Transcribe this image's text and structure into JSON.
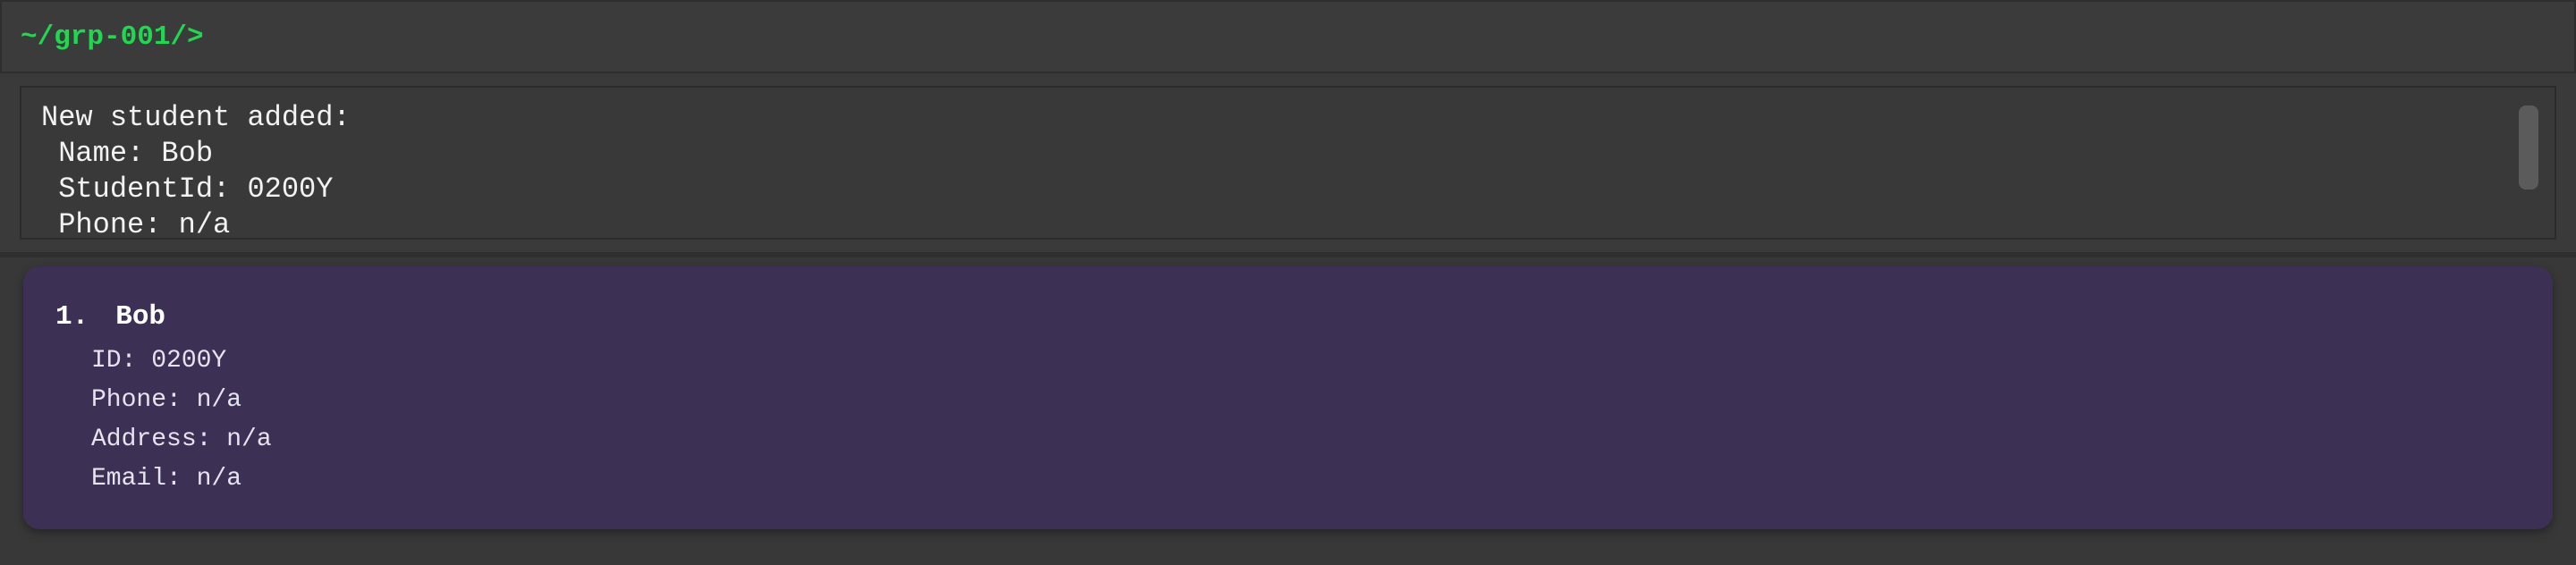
{
  "command_bar": {
    "prompt": "~/grp-001/>",
    "input_value": ""
  },
  "result_display": {
    "lines": [
      "New student added:",
      " Name: Bob",
      " StudentId: 0200Y",
      " Phone: n/a"
    ]
  },
  "student_list": {
    "items": [
      {
        "index": "1.",
        "name": "Bob",
        "id": "ID: 0200Y",
        "phone": "Phone: n/a",
        "address": "Address: n/a",
        "email": "Email: n/a"
      }
    ]
  },
  "colors": {
    "prompt": "#1ed84f",
    "background": "#383838",
    "card": "#3c3154",
    "text": "#f2f2f2"
  }
}
